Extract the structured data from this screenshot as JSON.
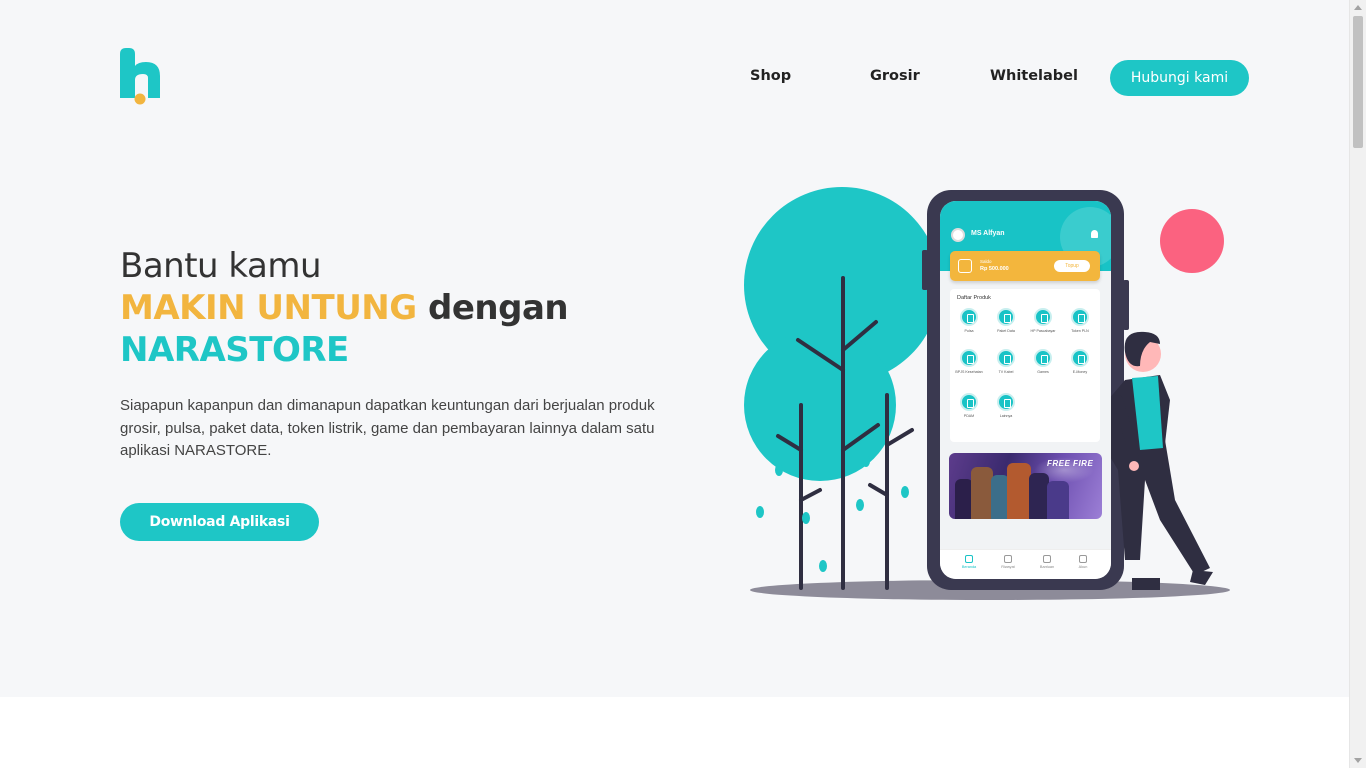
{
  "brand": {
    "logo_icon": "narastore-logo-icon",
    "accent_color": "#1ec6c6",
    "highlight_color": "#f2b53f"
  },
  "nav": {
    "items": [
      {
        "label": "Shop"
      },
      {
        "label": "Grosir"
      },
      {
        "label": "Whitelabel"
      }
    ],
    "contact_label": "Hubungi kami"
  },
  "hero": {
    "line1": "Bantu kamu",
    "highlight": "MAKIN UNTUNG",
    "line2_rest": " dengan",
    "brand_name": "NARASTORE",
    "description": "Siapapun kapanpun dan dimanapun dapatkan keuntungan dari berjualan produk grosir, pulsa, paket data, token listrik, game dan pembayaran lainnya dalam satu aplikasi NARASTORE.",
    "download_label": "Download Aplikasi"
  },
  "phone": {
    "user_name": "MS Alfyan",
    "balance_label": "Saldo",
    "balance_value": "Rp 500.000",
    "topup_label": "Topup",
    "products_title": "Daftar Produk",
    "products": [
      {
        "label": "Pulsa",
        "icon": "phone-icon"
      },
      {
        "label": "Paket Data",
        "icon": "wifi-icon"
      },
      {
        "label": "HP Pascabayar",
        "icon": "phone-icon"
      },
      {
        "label": "Token PLN",
        "icon": "lightning-icon"
      },
      {
        "label": "BPJS Kesehatan",
        "icon": "health-icon"
      },
      {
        "label": "TV Kabel",
        "icon": "tv-icon"
      },
      {
        "label": "Games",
        "icon": "gamepad-icon"
      },
      {
        "label": "E-Money",
        "icon": "wallet-icon"
      },
      {
        "label": "PDAM",
        "icon": "water-drop-icon"
      },
      {
        "label": "Lainnya",
        "icon": "grid-icon"
      }
    ],
    "banner_text": "FREE FIRE",
    "tabs": [
      {
        "label": "Beranda",
        "icon": "home-icon"
      },
      {
        "label": "Riwayat",
        "icon": "history-icon"
      },
      {
        "label": "Bantuan",
        "icon": "headset-icon"
      },
      {
        "label": "Akun",
        "icon": "account-icon"
      }
    ]
  }
}
